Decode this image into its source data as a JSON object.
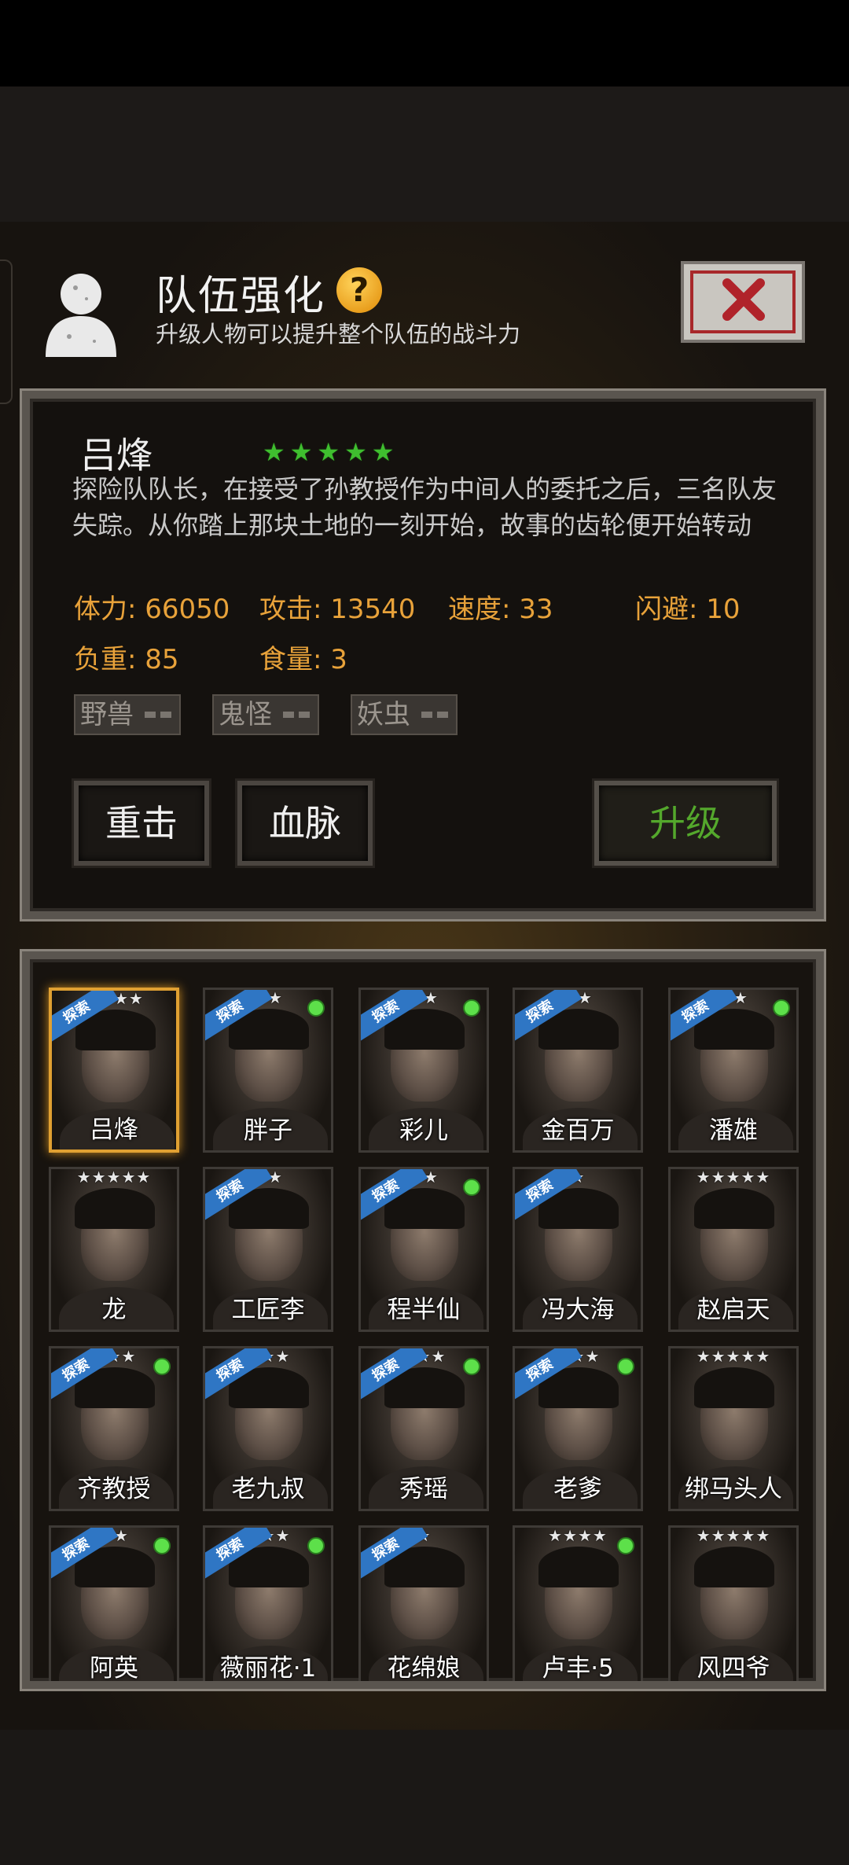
{
  "header": {
    "title": "队伍强化",
    "help_icon": "?",
    "subtitle": "升级人物可以提升整个队伍的战斗力"
  },
  "hero": {
    "name": "吕烽",
    "stars": 5,
    "description": "探险队队长，在接受了孙教授作为中间人的委托之后，三名队友失踪。从你踏上那块土地的一刻开始，故事的齿轮便开始转动",
    "stats": [
      {
        "label": "体力: 66050"
      },
      {
        "label": "攻击: 13540"
      },
      {
        "label": "速度: 33"
      },
      {
        "label": "闪避: 10"
      },
      {
        "label": "负重: 85"
      },
      {
        "label": "食量: 3"
      }
    ],
    "tags": [
      "野兽",
      "鬼怪",
      "妖虫"
    ],
    "buttons": {
      "heavy": "重击",
      "blood": "血脉",
      "upgrade": "升级"
    }
  },
  "ribbon_text": "探索",
  "characters": [
    {
      "name": "吕烽",
      "stars": "★★★★",
      "ribbon": true,
      "dot": false,
      "selected": true
    },
    {
      "name": "胖子",
      "stars": "★★",
      "ribbon": true,
      "dot": true
    },
    {
      "name": "彩儿",
      "stars": "★★",
      "ribbon": true,
      "dot": true
    },
    {
      "name": "金百万",
      "stars": "★★",
      "ribbon": true,
      "dot": false
    },
    {
      "name": "潘雄",
      "stars": "★★",
      "ribbon": true,
      "dot": true
    },
    {
      "name": "龙",
      "stars": "★★★★★",
      "ribbon": false,
      "dot": false
    },
    {
      "name": "工匠李",
      "stars": "★★",
      "ribbon": true,
      "dot": false
    },
    {
      "name": "程半仙",
      "stars": "★★",
      "ribbon": true,
      "dot": true
    },
    {
      "name": "冯大海",
      "stars": "★",
      "ribbon": true,
      "dot": false
    },
    {
      "name": "赵启天",
      "stars": "★★★★★",
      "ribbon": false,
      "dot": false
    },
    {
      "name": "齐教授",
      "stars": "★★★",
      "ribbon": true,
      "dot": true
    },
    {
      "name": "老九叔",
      "stars": "★★★",
      "ribbon": true,
      "dot": false
    },
    {
      "name": "秀瑶",
      "stars": "★★★",
      "ribbon": true,
      "dot": true
    },
    {
      "name": "老爹",
      "stars": "★★★",
      "ribbon": true,
      "dot": true
    },
    {
      "name": "绑马头人",
      "stars": "★★★★★",
      "ribbon": false,
      "dot": false
    },
    {
      "name": "阿英",
      "stars": "★★",
      "ribbon": true,
      "dot": true
    },
    {
      "name": "薇丽花·1",
      "stars": "★★★",
      "ribbon": true,
      "dot": true
    },
    {
      "name": "花绵娘",
      "stars": "★",
      "ribbon": true,
      "dot": false
    },
    {
      "name": "卢丰·5",
      "stars": "★★★★",
      "ribbon": false,
      "dot": true
    },
    {
      "name": "风四爷",
      "stars": "★★★★★",
      "ribbon": false,
      "dot": false
    }
  ]
}
